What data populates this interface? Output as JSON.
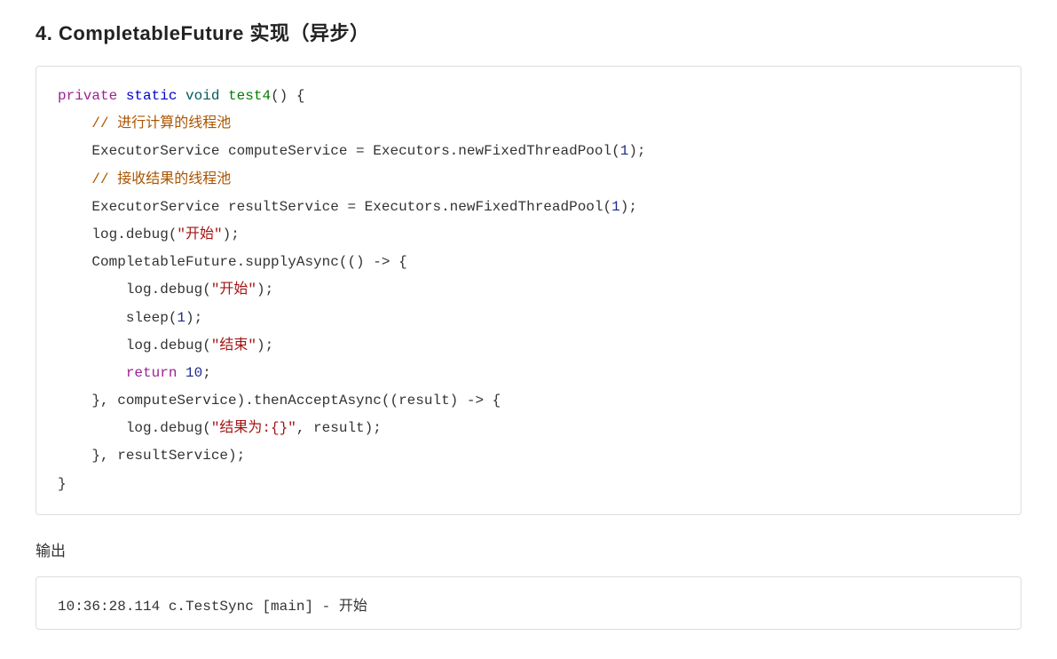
{
  "heading": "4. CompletableFuture 实现（异步）",
  "code_tokens": [
    {
      "cls": "kw-purple",
      "t": "private"
    },
    {
      "t": " "
    },
    {
      "cls": "kw-blue",
      "t": "static"
    },
    {
      "t": " "
    },
    {
      "cls": "kw-teal",
      "t": "void"
    },
    {
      "t": " "
    },
    {
      "cls": "kw-green",
      "t": "test4"
    },
    {
      "t": "() {\n"
    },
    {
      "t": "    "
    },
    {
      "cls": "comment",
      "t": "// 进行计算的线程池"
    },
    {
      "t": "\n"
    },
    {
      "t": "    ExecutorService computeService = Executors.newFixedThreadPool("
    },
    {
      "cls": "num",
      "t": "1"
    },
    {
      "t": ");\n"
    },
    {
      "t": "    "
    },
    {
      "cls": "comment",
      "t": "// 接收结果的线程池"
    },
    {
      "t": "\n"
    },
    {
      "t": "    ExecutorService resultService = Executors.newFixedThreadPool("
    },
    {
      "cls": "num",
      "t": "1"
    },
    {
      "t": ");\n"
    },
    {
      "t": "    log.debug("
    },
    {
      "cls": "str",
      "t": "\"开始\""
    },
    {
      "t": ");\n"
    },
    {
      "t": "    CompletableFuture.supplyAsync(() "
    },
    {
      "cls": "arrow",
      "t": "->"
    },
    {
      "t": " {\n"
    },
    {
      "t": "        log.debug("
    },
    {
      "cls": "str",
      "t": "\"开始\""
    },
    {
      "t": ");\n"
    },
    {
      "t": "        sleep("
    },
    {
      "cls": "num",
      "t": "1"
    },
    {
      "t": ");\n"
    },
    {
      "t": "        log.debug("
    },
    {
      "cls": "str",
      "t": "\"结束\""
    },
    {
      "t": ");\n"
    },
    {
      "t": "        "
    },
    {
      "cls": "kw-purple",
      "t": "return"
    },
    {
      "t": " "
    },
    {
      "cls": "num",
      "t": "10"
    },
    {
      "t": ";\n"
    },
    {
      "t": "    }, computeService).thenAcceptAsync((result) "
    },
    {
      "cls": "arrow",
      "t": "->"
    },
    {
      "t": " {\n"
    },
    {
      "t": "        log.debug("
    },
    {
      "cls": "str",
      "t": "\"结果为:{}\""
    },
    {
      "t": ", result);\n"
    },
    {
      "t": "    }, resultService);\n"
    },
    {
      "t": "}"
    }
  ],
  "output_label": "输出",
  "output_lines": [
    "10:36:28.114 c.TestSync [main] - 开始"
  ]
}
